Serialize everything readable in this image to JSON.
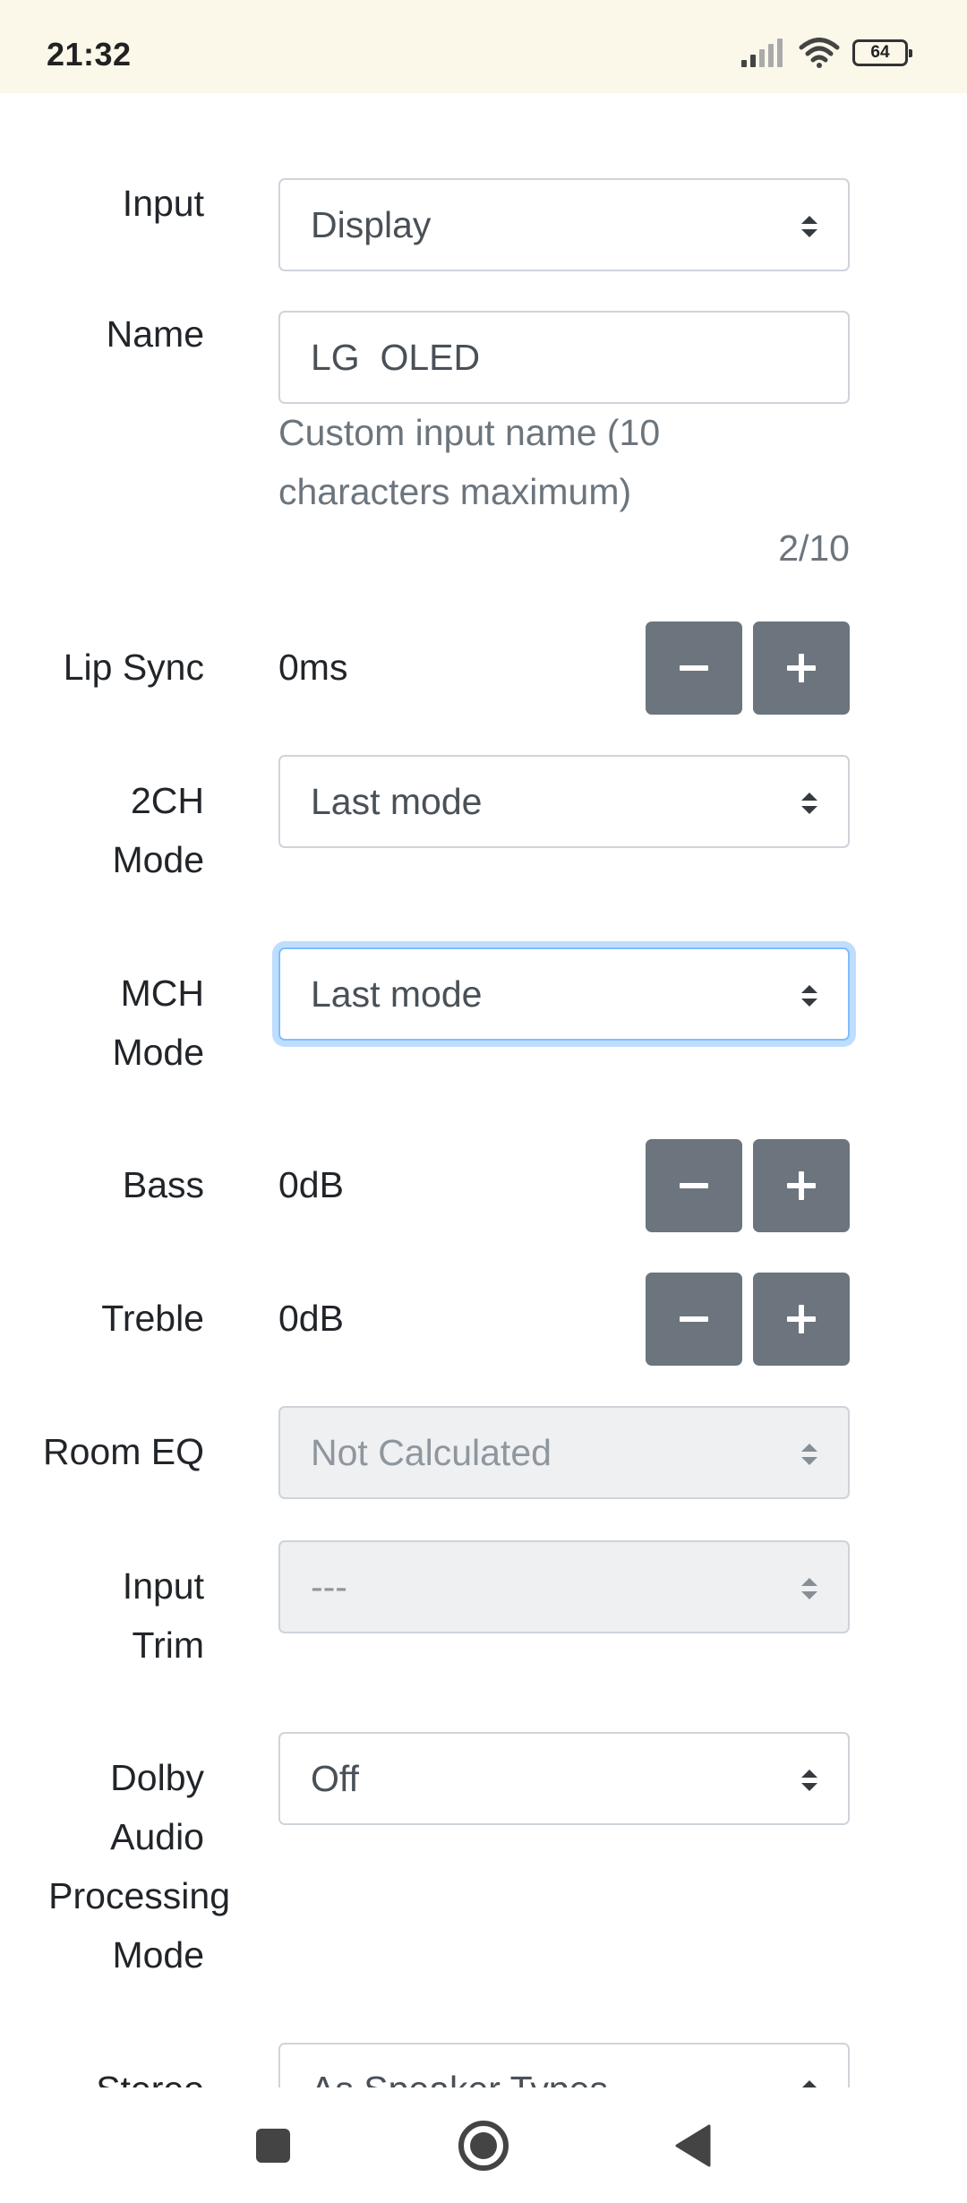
{
  "status_bar": {
    "time": "21:32",
    "battery": "64",
    "icons": [
      "signal-icon",
      "wifi-icon",
      "battery-icon"
    ]
  },
  "fields": {
    "input": {
      "label": "Input",
      "value": "Display"
    },
    "name": {
      "label": "Name",
      "value": "LG  OLED",
      "help": "Custom input name (10 characters maximum)",
      "counter": "2/10"
    },
    "lip_sync": {
      "label": "Lip Sync",
      "value": "0ms"
    },
    "ch2_mode": {
      "label_line1": "2CH",
      "label_line2": "Mode",
      "value": "Last mode"
    },
    "mch_mode": {
      "label_line1": "MCH",
      "label_line2": "Mode",
      "value": "Last mode"
    },
    "bass": {
      "label": "Bass",
      "value": "0dB"
    },
    "treble": {
      "label": "Treble",
      "value": "0dB"
    },
    "room_eq": {
      "label": "Room EQ",
      "value": "Not Calculated"
    },
    "input_trim": {
      "label_line1": "Input",
      "label_line2": "Trim",
      "value": "---"
    },
    "dolby": {
      "label_line1": "Dolby",
      "label_line2": "Audio",
      "label_line3": "Processing",
      "label_line4": "Mode",
      "value": "Off"
    },
    "stereo": {
      "label": "Stereo",
      "value": "As Speaker Types"
    }
  },
  "colors": {
    "status_bar_bg": "#fbf8ea",
    "button_bg": "#6c757d",
    "focus_border": "#80bdff",
    "disabled_bg": "#eef0f2"
  },
  "nav_bar": {
    "icons": [
      "recent-apps-icon",
      "home-icon",
      "back-icon"
    ]
  }
}
